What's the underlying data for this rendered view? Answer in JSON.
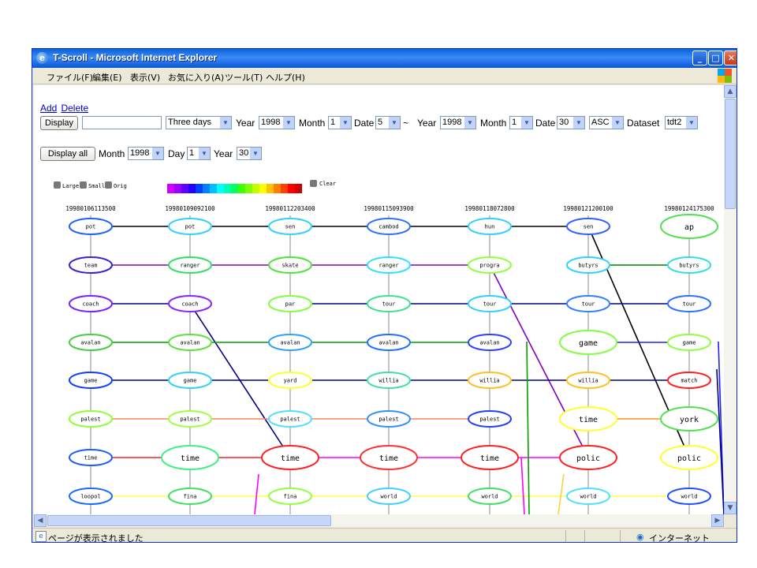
{
  "window": {
    "title": "T-Scroll - Microsoft Internet Explorer",
    "menu": [
      "ファイル(F)",
      "編集(E)",
      "表示(V)",
      "お気に入り(A)",
      "ツール(T)",
      "ヘルプ(H)"
    ],
    "status_text": "ページが表示されました",
    "zone_text": "インターネット"
  },
  "controls": {
    "add_link": "Add",
    "delete_link": "Delete",
    "display_button": "Display",
    "keyword_input": "",
    "period_select": "Three days",
    "year_label": "Year",
    "month_label": "Month",
    "date_label": "Date",
    "day_label": "Day",
    "tilde": "~",
    "dataset_label": "Dataset",
    "start_year": "1998",
    "start_month": "1",
    "start_date": "5",
    "end_year": "1998",
    "end_month": "1",
    "end_date": "30",
    "order_select": "ASC",
    "dataset_select": "tdt2",
    "display_all_button": "Display all",
    "all_month": "1998",
    "all_day": "1",
    "all_year": "30"
  },
  "legend": {
    "large": "Large",
    "small": "Small",
    "orig": "Orig",
    "clear": "Clear",
    "spectrum": [
      "#d000ff",
      "#a000ff",
      "#6000ff",
      "#2000ff",
      "#0040ff",
      "#0080ff",
      "#00c0ff",
      "#00ffff",
      "#00ffb0",
      "#00ff60",
      "#40ff00",
      "#80ff00",
      "#c0ff00",
      "#ffff00",
      "#ffc000",
      "#ff8000",
      "#ff4000",
      "#ff0000",
      "#d00000"
    ]
  },
  "graph": {
    "timestamps": [
      "19980106113500",
      "19980109092100",
      "19980112203400",
      "19980115093900",
      "19980118072800",
      "19980121200100",
      "19980124175300"
    ],
    "columns": [
      {
        "nodes": [
          {
            "label": "pot",
            "color": "#2060ff",
            "large": false
          },
          {
            "label": "team",
            "color": "#3a1fd6",
            "large": false
          },
          {
            "label": "coach",
            "color": "#7a20ff",
            "large": false
          },
          {
            "label": "avalan",
            "color": "#44cc44",
            "large": false
          },
          {
            "label": "game",
            "color": "#1040ff",
            "large": false
          },
          {
            "label": "palest",
            "color": "#90ff30",
            "large": false
          },
          {
            "label": "time",
            "color": "#1f5cff",
            "large": false
          },
          {
            "label": "loopol",
            "color": "#1a6aff",
            "large": false
          }
        ]
      },
      {
        "nodes": [
          {
            "label": "pot",
            "color": "#30d0ff",
            "large": false
          },
          {
            "label": "ranger",
            "color": "#30e060",
            "large": false
          },
          {
            "label": "coach",
            "color": "#9020ff",
            "large": false
          },
          {
            "label": "avalan",
            "color": "#60e040",
            "large": false
          },
          {
            "label": "game",
            "color": "#30d0ff",
            "large": false
          },
          {
            "label": "palest",
            "color": "#a0ff40",
            "large": false
          },
          {
            "label": "time",
            "color": "#40f080",
            "large": true
          },
          {
            "label": "fina",
            "color": "#40e060",
            "large": false
          }
        ]
      },
      {
        "nodes": [
          {
            "label": "sen",
            "color": "#30d0ff",
            "large": false
          },
          {
            "label": "skate",
            "color": "#50e040",
            "large": false
          },
          {
            "label": "par",
            "color": "#80ff40",
            "large": false
          },
          {
            "label": "avalan",
            "color": "#30a0ff",
            "large": false
          },
          {
            "label": "yard",
            "color": "#ffff30",
            "large": false
          },
          {
            "label": "palest",
            "color": "#50e0ff",
            "large": false
          },
          {
            "label": "time",
            "color": "#ff2020",
            "large": true
          },
          {
            "label": "fina",
            "color": "#90ff40",
            "large": false
          }
        ]
      },
      {
        "nodes": [
          {
            "label": "cambod",
            "color": "#3070ff",
            "large": false
          },
          {
            "label": "ranger",
            "color": "#30e0ff",
            "large": false
          },
          {
            "label": "tour",
            "color": "#40e090",
            "large": false
          },
          {
            "label": "avalan",
            "color": "#2070ff",
            "large": false
          },
          {
            "label": "willia",
            "color": "#40e0a0",
            "large": false
          },
          {
            "label": "palest",
            "color": "#3090ff",
            "large": false
          },
          {
            "label": "time",
            "color": "#ff3030",
            "large": true
          },
          {
            "label": "world",
            "color": "#40d0ff",
            "large": false
          }
        ]
      },
      {
        "nodes": [
          {
            "label": "hun",
            "color": "#30d0ff",
            "large": false
          },
          {
            "label": "progra",
            "color": "#90ff40",
            "large": false
          },
          {
            "label": "tour",
            "color": "#30d0ff",
            "large": false
          },
          {
            "label": "avalan",
            "color": "#3040ff",
            "large": false
          },
          {
            "label": "willia",
            "color": "#ffc020",
            "large": false
          },
          {
            "label": "palest",
            "color": "#2040ff",
            "large": false
          },
          {
            "label": "time",
            "color": "#ff2020",
            "large": true
          },
          {
            "label": "world",
            "color": "#40e060",
            "large": false
          }
        ]
      },
      {
        "nodes": [
          {
            "label": "sen",
            "color": "#3060ff",
            "large": false
          },
          {
            "label": "butyrs",
            "color": "#30d0ff",
            "large": false
          },
          {
            "label": "tour",
            "color": "#3080ff",
            "large": false
          },
          {
            "label": "game",
            "color": "#80ff40",
            "large": true
          },
          {
            "label": "willia",
            "color": "#ffc020",
            "large": false
          },
          {
            "label": "time",
            "color": "#ffff30",
            "large": true
          },
          {
            "label": "polic",
            "color": "#ff2020",
            "large": true
          },
          {
            "label": "world",
            "color": "#50e0ff",
            "large": false
          }
        ]
      },
      {
        "nodes": [
          {
            "label": "ap",
            "color": "#50e050",
            "large": true
          },
          {
            "label": "butyrs",
            "color": "#30e0e0",
            "large": false
          },
          {
            "label": "tour",
            "color": "#3070ff",
            "large": false
          },
          {
            "label": "game",
            "color": "#90ff40",
            "large": false
          },
          {
            "label": "match",
            "color": "#ff2020",
            "large": false
          },
          {
            "label": "york",
            "color": "#50e050",
            "large": true
          },
          {
            "label": "polic",
            "color": "#ffff30",
            "large": true
          },
          {
            "label": "world",
            "color": "#2050ff",
            "large": false
          }
        ]
      }
    ],
    "edges": [
      {
        "from": [
          0,
          0
        ],
        "to": [
          1,
          0
        ],
        "color": "#000000"
      },
      {
        "from": [
          1,
          0
        ],
        "to": [
          2,
          0
        ],
        "color": "#000000"
      },
      {
        "from": [
          2,
          0
        ],
        "to": [
          3,
          0
        ],
        "color": "#000000"
      },
      {
        "from": [
          3,
          0
        ],
        "to": [
          4,
          0
        ],
        "color": "#000000"
      },
      {
        "from": [
          4,
          0
        ],
        "to": [
          5,
          0
        ],
        "color": "#000000"
      },
      {
        "from": [
          5,
          0
        ],
        "to": [
          6,
          6
        ],
        "color": "#000000"
      },
      {
        "from": [
          0,
          1
        ],
        "to": [
          1,
          1
        ],
        "color": "#8000c0"
      },
      {
        "from": [
          1,
          1
        ],
        "to": [
          2,
          1
        ],
        "color": "#8000c0"
      },
      {
        "from": [
          2,
          1
        ],
        "to": [
          3,
          1
        ],
        "color": "#8000c0"
      },
      {
        "from": [
          3,
          1
        ],
        "to": [
          4,
          1
        ],
        "color": "#8000c0"
      },
      {
        "from": [
          4,
          1
        ],
        "to": [
          5,
          6
        ],
        "color": "#8000c0"
      },
      {
        "from": [
          5,
          1
        ],
        "to": [
          6,
          1
        ],
        "color": "#008000"
      },
      {
        "from": [
          0,
          2
        ],
        "to": [
          1,
          2
        ],
        "color": "#000080"
      },
      {
        "from": [
          1,
          2
        ],
        "to": [
          2,
          6
        ],
        "color": "#000080"
      },
      {
        "from": [
          2,
          2
        ],
        "to": [
          3,
          2
        ],
        "color": "#000080"
      },
      {
        "from": [
          3,
          2
        ],
        "to": [
          4,
          2
        ],
        "color": "#000080"
      },
      {
        "from": [
          4,
          2
        ],
        "to": [
          5,
          2
        ],
        "color": "#000080"
      },
      {
        "from": [
          5,
          2
        ],
        "to": [
          6,
          2
        ],
        "color": "#000080"
      },
      {
        "from": [
          0,
          3
        ],
        "to": [
          1,
          3
        ],
        "color": "#00a000"
      },
      {
        "from": [
          1,
          3
        ],
        "to": [
          2,
          3
        ],
        "color": "#00a000"
      },
      {
        "from": [
          2,
          3
        ],
        "to": [
          3,
          3
        ],
        "color": "#00a000"
      },
      {
        "from": [
          3,
          3
        ],
        "to": [
          4,
          3
        ],
        "color": "#00a000"
      },
      {
        "from": [
          5,
          3
        ],
        "to": [
          6,
          3
        ],
        "color": "#2020ff"
      },
      {
        "from": [
          0,
          4
        ],
        "to": [
          1,
          4
        ],
        "color": "#000080"
      },
      {
        "from": [
          1,
          4
        ],
        "to": [
          2,
          4
        ],
        "color": "#000080"
      },
      {
        "from": [
          2,
          4
        ],
        "to": [
          3,
          4
        ],
        "color": "#000080"
      },
      {
        "from": [
          3,
          4
        ],
        "to": [
          4,
          4
        ],
        "color": "#000080"
      },
      {
        "from": [
          4,
          4
        ],
        "to": [
          5,
          4
        ],
        "color": "#000080"
      },
      {
        "from": [
          5,
          4
        ],
        "to": [
          6,
          4
        ],
        "color": "#000080"
      },
      {
        "from": [
          0,
          5
        ],
        "to": [
          1,
          5
        ],
        "color": "#ff8060"
      },
      {
        "from": [
          1,
          5
        ],
        "to": [
          2,
          5
        ],
        "color": "#ff8060"
      },
      {
        "from": [
          2,
          5
        ],
        "to": [
          3,
          5
        ],
        "color": "#ff8060"
      },
      {
        "from": [
          3,
          5
        ],
        "to": [
          4,
          5
        ],
        "color": "#ff8060"
      },
      {
        "from": [
          5,
          5
        ],
        "to": [
          6,
          5
        ],
        "color": "#ff9020"
      },
      {
        "from": [
          0,
          6
        ],
        "to": [
          1,
          6
        ],
        "color": "#ff2020"
      },
      {
        "from": [
          1,
          6
        ],
        "to": [
          2,
          6
        ],
        "color": "#ff2020"
      },
      {
        "from": [
          2,
          6
        ],
        "to": [
          3,
          6
        ],
        "color": "#ff00ff"
      },
      {
        "from": [
          3,
          6
        ],
        "to": [
          4,
          6
        ],
        "color": "#ff00ff"
      },
      {
        "from": [
          4,
          6
        ],
        "to": [
          5,
          6
        ],
        "color": "#ff00ff"
      },
      {
        "from": [
          0,
          7
        ],
        "to": [
          1,
          7
        ],
        "color": "#ffff40"
      },
      {
        "from": [
          1,
          7
        ],
        "to": [
          2,
          7
        ],
        "color": "#ffff40"
      },
      {
        "from": [
          2,
          7
        ],
        "to": [
          3,
          7
        ],
        "color": "#ffff40"
      },
      {
        "from": [
          3,
          7
        ],
        "to": [
          4,
          7
        ],
        "color": "#ffff40"
      },
      {
        "from": [
          4,
          7
        ],
        "to": [
          5,
          7
        ],
        "color": "#ffff40"
      },
      {
        "from": [
          5,
          7
        ],
        "to": [
          6,
          7
        ],
        "color": "#ffff40"
      }
    ]
  }
}
